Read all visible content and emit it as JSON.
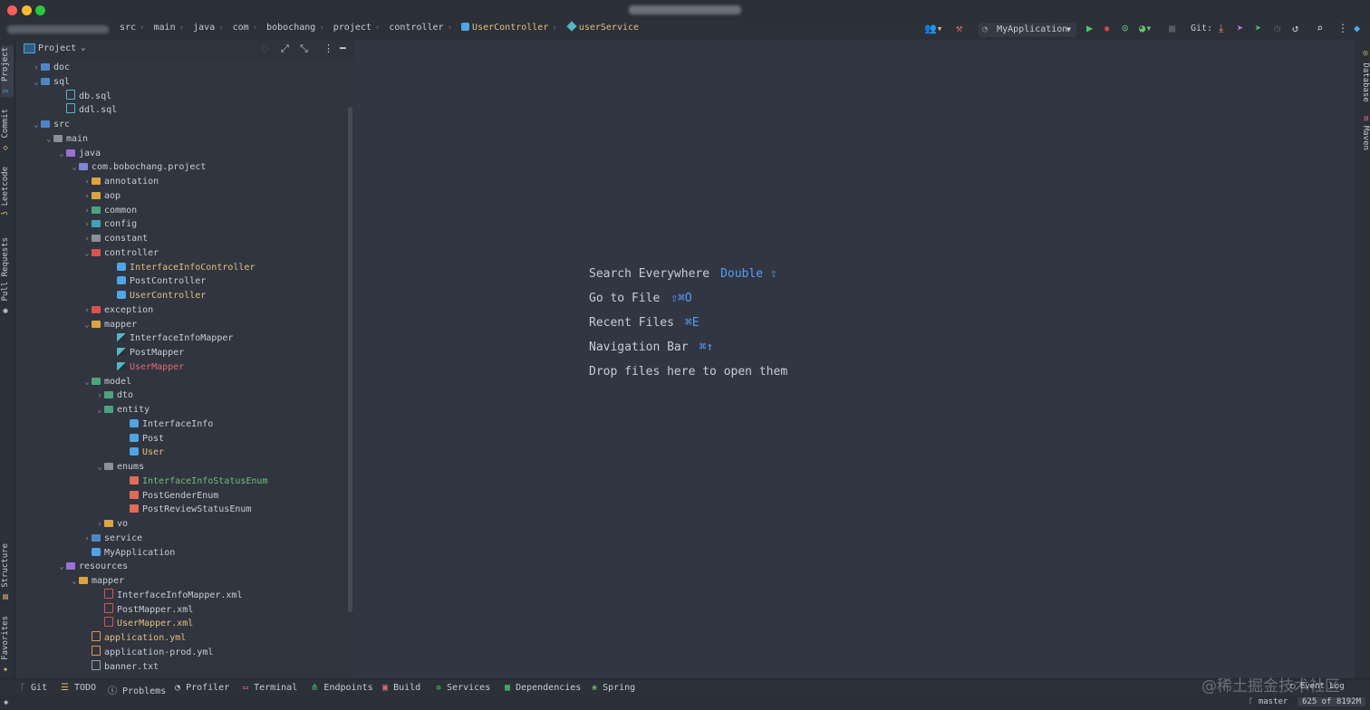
{
  "breadcrumb": [
    "src",
    "main",
    "java",
    "com",
    "bobochang",
    "project",
    "controller",
    "UserController",
    "userService"
  ],
  "toolbar": {
    "run_config": "MyApplication",
    "git_label": "Git:"
  },
  "left_tabs": {
    "project": "Project",
    "commit": "Commit",
    "leetcode": "Leetcode",
    "pull_requests": "Pull Requests",
    "structure": "Structure",
    "favorites": "Favorites"
  },
  "right_tabs": {
    "database": "Database",
    "maven": "Maven"
  },
  "project_panel": {
    "title": "Project"
  },
  "tree": [
    {
      "label": "doc",
      "indent": 1,
      "arrow": "right",
      "icon": "folder-blue",
      "color": "#c8ccd4"
    },
    {
      "label": "sql",
      "indent": 1,
      "arrow": "down",
      "icon": "folder-blue",
      "color": "#c8ccd4"
    },
    {
      "label": "db.sql",
      "indent": 3,
      "arrow": "",
      "icon": "sql-file",
      "color": "#c8ccd4"
    },
    {
      "label": "ddl.sql",
      "indent": 3,
      "arrow": "",
      "icon": "sql-file",
      "color": "#c8ccd4"
    },
    {
      "label": "src",
      "indent": 1,
      "arrow": "down",
      "icon": "folder-blue",
      "color": "#c8ccd4"
    },
    {
      "label": "main",
      "indent": 2,
      "arrow": "down",
      "icon": "folder-gray",
      "color": "#c8ccd4"
    },
    {
      "label": "java",
      "indent": 3,
      "arrow": "down",
      "icon": "folder-purple",
      "color": "#c8ccd4"
    },
    {
      "label": "com.bobochang.project",
      "indent": 4,
      "arrow": "down",
      "icon": "package",
      "color": "#c8ccd4"
    },
    {
      "label": "annotation",
      "indent": 5,
      "arrow": "right",
      "icon": "folder-yellow",
      "color": "#c8ccd4"
    },
    {
      "label": "aop",
      "indent": 5,
      "arrow": "right",
      "icon": "folder-yellow",
      "color": "#c8ccd4"
    },
    {
      "label": "common",
      "indent": 5,
      "arrow": "right",
      "icon": "folder-green",
      "color": "#c8ccd4"
    },
    {
      "label": "config",
      "indent": 5,
      "arrow": "right",
      "icon": "folder-cyan",
      "color": "#c8ccd4"
    },
    {
      "label": "constant",
      "indent": 5,
      "arrow": "right",
      "icon": "folder-gray",
      "color": "#c8ccd4"
    },
    {
      "label": "controller",
      "indent": 5,
      "arrow": "down",
      "icon": "folder-red",
      "color": "#c8ccd4"
    },
    {
      "label": "InterfaceInfoController",
      "indent": 7,
      "arrow": "",
      "icon": "class",
      "color": "#e5c07b"
    },
    {
      "label": "PostController",
      "indent": 7,
      "arrow": "",
      "icon": "class",
      "color": "#c8ccd4"
    },
    {
      "label": "UserController",
      "indent": 7,
      "arrow": "",
      "icon": "class",
      "color": "#e5c07b"
    },
    {
      "label": "exception",
      "indent": 5,
      "arrow": "right",
      "icon": "folder-red",
      "color": "#c8ccd4"
    },
    {
      "label": "mapper",
      "indent": 5,
      "arrow": "down",
      "icon": "folder-yellow",
      "color": "#c8ccd4"
    },
    {
      "label": "InterfaceInfoMapper",
      "indent": 7,
      "arrow": "",
      "icon": "mapper",
      "color": "#c8ccd4"
    },
    {
      "label": "PostMapper",
      "indent": 7,
      "arrow": "",
      "icon": "mapper",
      "color": "#c8ccd4"
    },
    {
      "label": "UserMapper",
      "indent": 7,
      "arrow": "",
      "icon": "mapper",
      "color": "#e06c75"
    },
    {
      "label": "model",
      "indent": 5,
      "arrow": "down",
      "icon": "folder-green",
      "color": "#c8ccd4"
    },
    {
      "label": "dto",
      "indent": 6,
      "arrow": "right",
      "icon": "folder-green",
      "color": "#c8ccd4"
    },
    {
      "label": "entity",
      "indent": 6,
      "arrow": "down",
      "icon": "folder-green",
      "color": "#c8ccd4"
    },
    {
      "label": "InterfaceInfo",
      "indent": 8,
      "arrow": "",
      "icon": "class",
      "color": "#c8ccd4"
    },
    {
      "label": "Post",
      "indent": 8,
      "arrow": "",
      "icon": "class",
      "color": "#c8ccd4"
    },
    {
      "label": "User",
      "indent": 8,
      "arrow": "",
      "icon": "class",
      "color": "#e5c07b"
    },
    {
      "label": "enums",
      "indent": 6,
      "arrow": "down",
      "icon": "folder-gray",
      "color": "#c8ccd4"
    },
    {
      "label": "InterfaceInfoStatusEnum",
      "indent": 8,
      "arrow": "",
      "icon": "enum",
      "color": "#6fbf73"
    },
    {
      "label": "PostGenderEnum",
      "indent": 8,
      "arrow": "",
      "icon": "enum",
      "color": "#c8ccd4"
    },
    {
      "label": "PostReviewStatusEnum",
      "indent": 8,
      "arrow": "",
      "icon": "enum",
      "color": "#c8ccd4"
    },
    {
      "label": "vo",
      "indent": 6,
      "arrow": "right",
      "icon": "folder-yellow",
      "color": "#c8ccd4"
    },
    {
      "label": "service",
      "indent": 5,
      "arrow": "right",
      "icon": "folder-blue",
      "color": "#c8ccd4"
    },
    {
      "label": "MyApplication",
      "indent": 5,
      "arrow": "",
      "icon": "app-class",
      "color": "#c8ccd4"
    },
    {
      "label": "resources",
      "indent": 3,
      "arrow": "down",
      "icon": "folder-purple",
      "color": "#c8ccd4"
    },
    {
      "label": "mapper",
      "indent": 4,
      "arrow": "down",
      "icon": "folder-yellow",
      "color": "#c8ccd4"
    },
    {
      "label": "InterfaceInfoMapper.xml",
      "indent": 6,
      "arrow": "",
      "icon": "xml",
      "color": "#c8ccd4"
    },
    {
      "label": "PostMapper.xml",
      "indent": 6,
      "arrow": "",
      "icon": "xml",
      "color": "#c8ccd4"
    },
    {
      "label": "UserMapper.xml",
      "indent": 6,
      "arrow": "",
      "icon": "xml",
      "color": "#e5c07b"
    },
    {
      "label": "application.yml",
      "indent": 5,
      "arrow": "",
      "icon": "yml",
      "color": "#e5c07b"
    },
    {
      "label": "application-prod.yml",
      "indent": 5,
      "arrow": "",
      "icon": "yml",
      "color": "#c8ccd4"
    },
    {
      "label": "banner.txt",
      "indent": 5,
      "arrow": "",
      "icon": "text",
      "color": "#c8ccd4"
    }
  ],
  "editor_hints": [
    {
      "label": "Search Everywhere",
      "key": "Double ⇧"
    },
    {
      "label": "Go to File",
      "key": "⇧⌘O"
    },
    {
      "label": "Recent Files",
      "key": "⌘E"
    },
    {
      "label": "Navigation Bar",
      "key": "⌘↑"
    },
    {
      "label": "Drop files here to open them",
      "key": ""
    }
  ],
  "bottom_tabs": [
    "Git",
    "TODO",
    "Problems",
    "Profiler",
    "Terminal",
    "Endpoints",
    "Build",
    "Services",
    "Dependencies",
    "Spring"
  ],
  "event_log": "Event Log",
  "watermark": "@稀土掘金技术社区",
  "status": {
    "branch": "master",
    "memory": "625 of 8192M"
  },
  "colors": {
    "accent_blue": "#589df6",
    "class_icon": "#4fa6e6",
    "modified": "#e5c07b",
    "error": "#e06c75",
    "new_file": "#6fbf73"
  }
}
